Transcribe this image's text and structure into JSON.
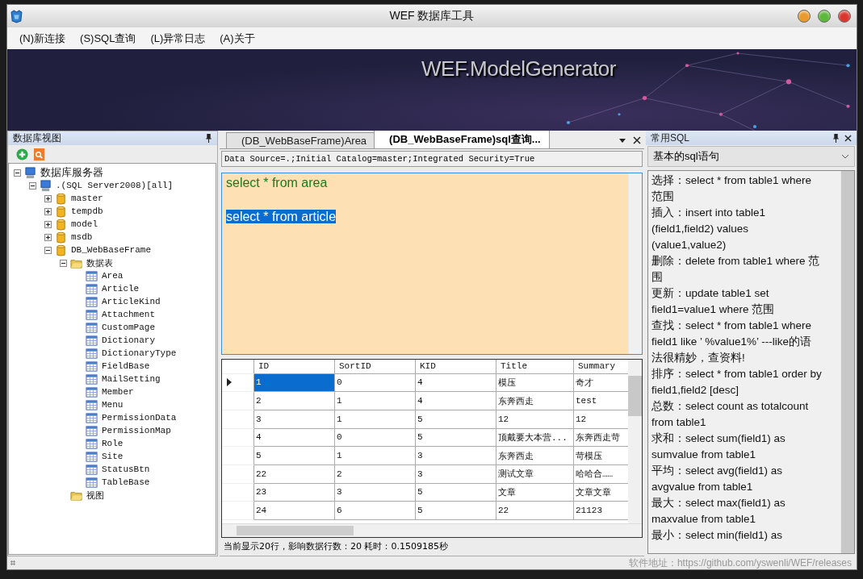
{
  "window": {
    "title": "WEF 数据库工具"
  },
  "menu": [
    "(N)新连接",
    "(S)SQL查询",
    "(L)异常日志",
    "(A)关于"
  ],
  "banner": {
    "title": "WEF.ModelGenerator"
  },
  "left_panel": {
    "title": "数据库视图",
    "tree": [
      {
        "label": "数据库服务器",
        "kind": "server",
        "expanded": true,
        "children": [
          {
            "label": ".(SQL Server2008)[all]",
            "kind": "server",
            "expanded": true,
            "children": [
              {
                "label": "master",
                "kind": "database",
                "expanded": false
              },
              {
                "label": "tempdb",
                "kind": "database",
                "expanded": false
              },
              {
                "label": "model",
                "kind": "database",
                "expanded": false
              },
              {
                "label": "msdb",
                "kind": "database",
                "expanded": false
              },
              {
                "label": "DB_WebBaseFrame",
                "kind": "database",
                "expanded": true,
                "children": [
                  {
                    "label": "数据表",
                    "kind": "folder",
                    "expanded": true,
                    "children": [
                      {
                        "label": "Area",
                        "kind": "table"
                      },
                      {
                        "label": "Article",
                        "kind": "table"
                      },
                      {
                        "label": "ArticleKind",
                        "kind": "table"
                      },
                      {
                        "label": "Attachment",
                        "kind": "table"
                      },
                      {
                        "label": "CustomPage",
                        "kind": "table"
                      },
                      {
                        "label": "Dictionary",
                        "kind": "table"
                      },
                      {
                        "label": "DictionaryType",
                        "kind": "table"
                      },
                      {
                        "label": "FieldBase",
                        "kind": "table"
                      },
                      {
                        "label": "MailSetting",
                        "kind": "table"
                      },
                      {
                        "label": "Member",
                        "kind": "table"
                      },
                      {
                        "label": "Menu",
                        "kind": "table"
                      },
                      {
                        "label": "PermissionData",
                        "kind": "table"
                      },
                      {
                        "label": "PermissionMap",
                        "kind": "table"
                      },
                      {
                        "label": "Role",
                        "kind": "table"
                      },
                      {
                        "label": "Site",
                        "kind": "table"
                      },
                      {
                        "label": "StatusBtn",
                        "kind": "table"
                      },
                      {
                        "label": "TableBase",
                        "kind": "table"
                      }
                    ]
                  },
                  {
                    "label": "视图",
                    "kind": "folder"
                  }
                ]
              }
            ]
          }
        ]
      }
    ]
  },
  "tabs": [
    {
      "label": "(DB_WebBaseFrame)Area",
      "selected": false
    },
    {
      "label": "(DB_WebBaseFrame)sql查询...",
      "selected": true
    }
  ],
  "connection_string": "Data Source=.;Initial Catalog=master;Integrated Security=True",
  "editor": {
    "lines": [
      {
        "text": "select * from area",
        "selected": false
      },
      {
        "text": "select * from article",
        "selected": true
      }
    ]
  },
  "grid": {
    "columns": [
      "ID",
      "SortID",
      "KID",
      "Title",
      "Summary"
    ],
    "rows": [
      {
        "selected": true,
        "cells": [
          "1",
          "0",
          "4",
          "模压",
          "奇才"
        ]
      },
      {
        "selected": false,
        "cells": [
          "2",
          "1",
          "4",
          "东奔西走",
          "test"
        ]
      },
      {
        "selected": false,
        "cells": [
          "3",
          "1",
          "5",
          "12",
          "12"
        ]
      },
      {
        "selected": false,
        "cells": [
          "4",
          "0",
          "5",
          "顶戴要大本营...",
          "东奔西走苛"
        ]
      },
      {
        "selected": false,
        "cells": [
          "5",
          "1",
          "3",
          "东奔西走",
          "苛模压"
        ]
      },
      {
        "selected": false,
        "cells": [
          "22",
          "2",
          "3",
          "测试文章",
          "哈哈合……"
        ]
      },
      {
        "selected": false,
        "cells": [
          "23",
          "3",
          "5",
          "文章",
          "文章文章"
        ]
      },
      {
        "selected": false,
        "cells": [
          "24",
          "6",
          "5",
          "22",
          "21123"
        ]
      }
    ]
  },
  "status": "当前显示20行，影响数据行数：20 耗时：0.1509185秒",
  "right_panel": {
    "title": "常用SQL",
    "dropdown": "基本的sql语句",
    "entries": [
      "选择：select * from table1 where 范围",
      "插入：insert into table1 (field1,field2) values (value1,value2)",
      "删除：delete from table1 where 范围",
      "更新：update table1 set field1=value1 where 范围",
      "查找：select * from table1 where field1 like ’ %value1%’ ---like的语法很精妙，查资料!",
      "排序：select * from table1 order by field1,field2 [desc]",
      "总数：select count as totalcount from table1",
      "求和：select sum(field1) as sumvalue from table1",
      "平均：select avg(field1) as avgvalue from table1",
      "最大：select max(field1) as maxvalue from table1",
      "最小：select min(field1) as"
    ]
  },
  "footer": "软件地址：https://github.com/yswenli/WEF/releases"
}
